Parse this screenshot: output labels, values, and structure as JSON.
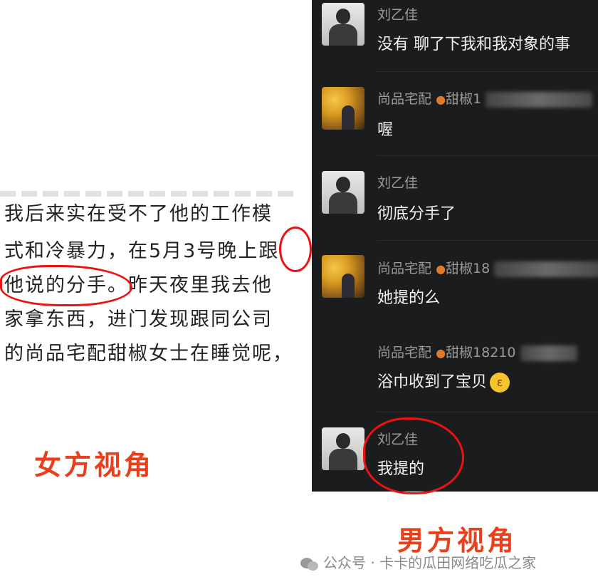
{
  "left_screenshot": {
    "lines": [
      "我后来实在受不了他的工作模",
      "式和冷暴力，在5月3号晚上跟",
      "他说的分手。昨天夜里我去他",
      "家拿东西，进门发现跟同公司",
      "的尚品宅配甜椒女士在睡觉呢，"
    ]
  },
  "captions": {
    "female": "女方视角",
    "male": "男方视角"
  },
  "chat": {
    "messages": [
      {
        "name": "刘乙佳",
        "text": "没有 聊了下我和我对象的事",
        "avatar": "man"
      },
      {
        "name": "尚品宅配",
        "name_suffix": "甜椒1",
        "text": "喔",
        "avatar": "woman"
      },
      {
        "name": "刘乙佳",
        "text": "彻底分手了",
        "avatar": "man"
      },
      {
        "name": "尚品宅配",
        "name_suffix": "甜椒18",
        "text": "她提的么",
        "avatar": "woman"
      },
      {
        "name": "尚品宅配",
        "name_suffix": "甜椒18210",
        "text": "浴巾收到了宝贝",
        "avatar": "none"
      },
      {
        "name": "刘乙佳",
        "text": "我提的",
        "avatar": "man"
      }
    ]
  },
  "watermark": {
    "text": "公众号 · 卡卡的瓜田网络吃瓜之家"
  },
  "colors": {
    "chat_bg": "#1b1c1e",
    "caption": "#e8401c",
    "highlight_circle": "#ee1111"
  }
}
